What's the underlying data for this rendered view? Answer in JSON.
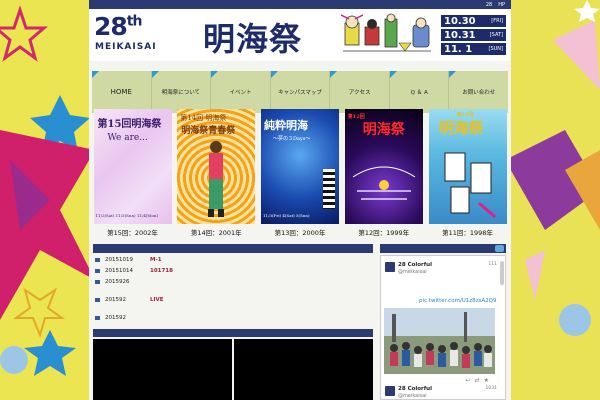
{
  "topbar": {
    "links": [
      "28",
      "HP"
    ]
  },
  "header": {
    "logo_number": "28",
    "logo_suffix": "th",
    "logo_romaji": "MEIKAISAI",
    "logo_kanji": "明海祭",
    "dates": [
      {
        "date": "10.30",
        "weekday": "[FRI]"
      },
      {
        "date": "10.31",
        "weekday": "[SAT]"
      },
      {
        "date": "11. 1",
        "weekday": "[SUN]"
      }
    ]
  },
  "nav": [
    {
      "label": "HOME"
    },
    {
      "label": "明海祭について"
    },
    {
      "label": "イベント"
    },
    {
      "label": "キャンパスマップ"
    },
    {
      "label": "アクセス"
    },
    {
      "label": "Q ＆ A"
    },
    {
      "label": "お問い合わせ"
    }
  ],
  "posters": [
    {
      "caption": "第15回：2002年",
      "title": "第15回明海祭",
      "subtitle": "We are...",
      "dates": "11/2(Sat) 11/3(Sun) 11/4(Mon)"
    },
    {
      "caption": "第14回：2001年",
      "title": "第14回 明海祭",
      "subtitle": "明海祭青春祭"
    },
    {
      "caption": "第13回：2000年",
      "title": "純粋明海",
      "subtitle": "～夢の３Days～",
      "dates": "11/3(Fri) 4(Sat) 5(Sun)"
    },
    {
      "caption": "第12回：1999年",
      "title": "明海祭",
      "subtitle": "第12回"
    },
    {
      "caption": "第11回：1998年",
      "title": "明海祭",
      "subtitle": "第11回"
    }
  ],
  "news": [
    {
      "date": "20151019",
      "title": "M-1"
    },
    {
      "date": "20151014",
      "title": "101718"
    },
    {
      "date": "2015926",
      "title": ""
    },
    {
      "date": "201592",
      "title": "LIVE"
    },
    {
      "date": "201592",
      "title": ""
    }
  ],
  "twitter": {
    "tweets": [
      {
        "name": "28 Colorful",
        "handle": "@meikaisai",
        "time": "111"
      },
      {
        "name": "28 Colorful",
        "handle": "@meikaisai",
        "time": "1031"
      }
    ],
    "link": "pic.twitter.com/U1z8zsA2Q9"
  },
  "colors": {
    "navy": "#2b3a73",
    "nav_bg": "#cfd9a4",
    "accent_blue": "#2a9bd6",
    "news_red": "#a2223a"
  }
}
